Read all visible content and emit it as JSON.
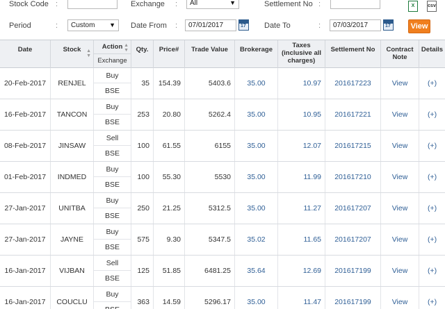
{
  "filters": {
    "stock_code_label": "Stock Code",
    "stock_code_value": "",
    "exchange_label": "Exchange",
    "exchange_value": "All",
    "settlement_label": "Settlement No",
    "settlement_value": "",
    "period_label": "Period",
    "period_value": "Custom",
    "date_from_label": "Date From",
    "date_from_value": "07/01/2017",
    "date_to_label": "Date To",
    "date_to_value": "07/03/2017",
    "calendar_day": "17",
    "view_label": "View",
    "xls_label": "X",
    "csv_label": "csv",
    "colon": ":"
  },
  "table": {
    "headers": {
      "date": "Date",
      "stock": "Stock",
      "action": "Action",
      "exchange": "Exchange",
      "qty": "Qty.",
      "price": "Price#",
      "trade_value": "Trade Value",
      "brokerage": "Brokerage",
      "taxes": "Taxes (inclusive all charges)",
      "settlement": "Settlement No",
      "contract": "Contract Note",
      "details": "Details"
    },
    "rows": [
      {
        "date": "20-Feb-2017",
        "stock": "RENJEL",
        "action": "Buy",
        "exchange": "BSE",
        "qty": "35",
        "price": "154.39",
        "trade_value": "5403.6",
        "brokerage": "35.00",
        "taxes": "10.97",
        "settlement": "201617223",
        "contract": "View",
        "details": "(+)"
      },
      {
        "date": "16-Feb-2017",
        "stock": "TANCON",
        "action": "Buy",
        "exchange": "BSE",
        "qty": "253",
        "price": "20.80",
        "trade_value": "5262.4",
        "brokerage": "35.00",
        "taxes": "10.95",
        "settlement": "201617221",
        "contract": "View",
        "details": "(+)"
      },
      {
        "date": "08-Feb-2017",
        "stock": "JINSAW",
        "action": "Sell",
        "exchange": "BSE",
        "qty": "100",
        "price": "61.55",
        "trade_value": "6155",
        "brokerage": "35.00",
        "taxes": "12.07",
        "settlement": "201617215",
        "contract": "View",
        "details": "(+)"
      },
      {
        "date": "01-Feb-2017",
        "stock": "INDMED",
        "action": "Buy",
        "exchange": "BSE",
        "qty": "100",
        "price": "55.30",
        "trade_value": "5530",
        "brokerage": "35.00",
        "taxes": "11.99",
        "settlement": "201617210",
        "contract": "View",
        "details": "(+)"
      },
      {
        "date": "27-Jan-2017",
        "stock": "UNITBA",
        "action": "Buy",
        "exchange": "BSE",
        "qty": "250",
        "price": "21.25",
        "trade_value": "5312.5",
        "brokerage": "35.00",
        "taxes": "11.27",
        "settlement": "201617207",
        "contract": "View",
        "details": "(+)"
      },
      {
        "date": "27-Jan-2017",
        "stock": "JAYNE",
        "action": "Buy",
        "exchange": "BSE",
        "qty": "575",
        "price": "9.30",
        "trade_value": "5347.5",
        "brokerage": "35.02",
        "taxes": "11.65",
        "settlement": "201617207",
        "contract": "View",
        "details": "(+)"
      },
      {
        "date": "16-Jan-2017",
        "stock": "VIJBAN",
        "action": "Sell",
        "exchange": "BSE",
        "qty": "125",
        "price": "51.85",
        "trade_value": "6481.25",
        "brokerage": "35.64",
        "taxes": "12.69",
        "settlement": "201617199",
        "contract": "View",
        "details": "(+)"
      },
      {
        "date": "16-Jan-2017",
        "stock": "COUCLU",
        "action": "Buy",
        "exchange": "BSE",
        "qty": "363",
        "price": "14.59",
        "trade_value": "5296.17",
        "brokerage": "35.00",
        "taxes": "11.47",
        "settlement": "201617199",
        "contract": "View",
        "details": "(+)"
      }
    ]
  },
  "colors": {
    "accent": "#f07f1e",
    "link": "#2f5f96",
    "header_bg": "#eef0f3"
  }
}
